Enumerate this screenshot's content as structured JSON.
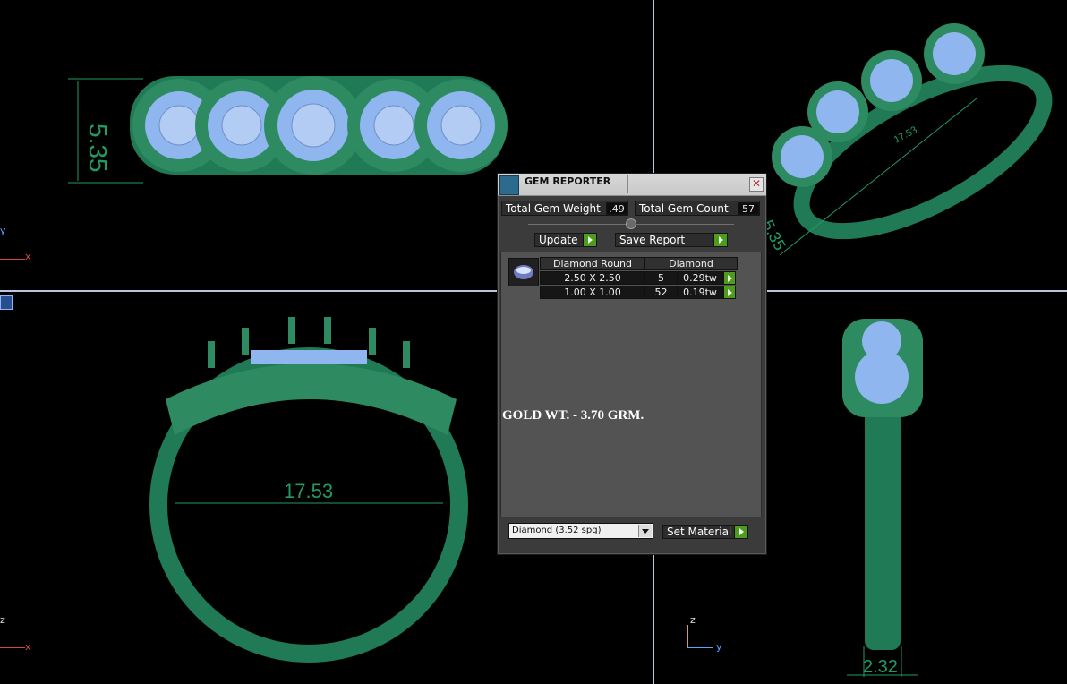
{
  "viewports": {
    "top_left": {
      "dimension": "5.35",
      "axes": [
        "y",
        "x"
      ]
    },
    "top_right": {
      "dimensions": [
        "17.53",
        "5.35"
      ]
    },
    "bottom_left": {
      "dimension": "17.53",
      "axes": [
        "z",
        "x"
      ]
    },
    "bottom_right": {
      "dimension": "2.32",
      "axes": [
        "z",
        "y"
      ]
    }
  },
  "gem_reporter": {
    "title": "GEM REPORTER",
    "total_weight_label": "Total Gem Weight",
    "total_weight_value": ".49",
    "total_count_label": "Total Gem Count",
    "total_count_value": "57",
    "update_label": "Update",
    "save_report_label": "Save Report",
    "table": {
      "headers": [
        "Diamond Round",
        "Diamond"
      ],
      "rows": [
        {
          "size": "2.50 X 2.50",
          "count": "5",
          "weight": "0.29tw"
        },
        {
          "size": "1.00 X 1.00",
          "count": "52",
          "weight": "0.19tw"
        }
      ]
    },
    "note": "GOLD WT. - 3.70 GRM.",
    "material_select": "Diamond     (3.52 spg)",
    "set_material_label": "Set Material"
  },
  "colors": {
    "metal": "#1f7a55",
    "gem": "#8fb6ef",
    "accent_green": "#4f9b1e"
  }
}
